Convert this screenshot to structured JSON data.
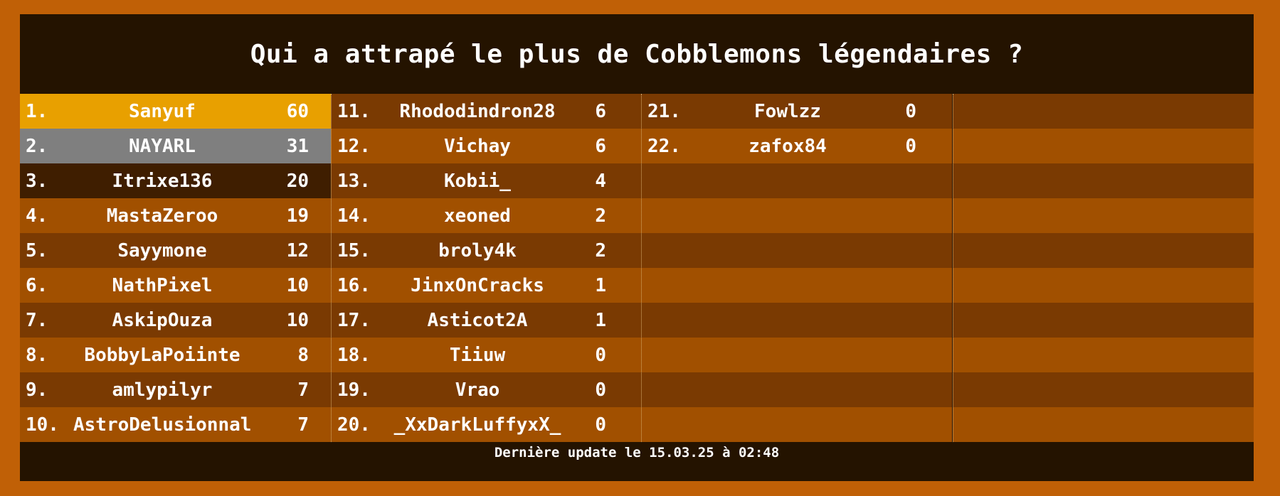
{
  "title": "Qui a attrapé le plus de Cobblemons légendaires ?",
  "footer": "Dernière update le 15.03.25 à 02:48",
  "colors": {
    "frame": "#c06006",
    "board": "#241300",
    "row_dark": "#7a3a02",
    "row_light": "#a15000",
    "gold": "#e8a000",
    "silver": "#7f7f7f",
    "bronze": "#3f1e00"
  },
  "entries": [
    {
      "rank": "1.",
      "name": "Sanyuf",
      "score": "60"
    },
    {
      "rank": "2.",
      "name": "NAYARL",
      "score": "31"
    },
    {
      "rank": "3.",
      "name": "Itrixe136",
      "score": "20"
    },
    {
      "rank": "4.",
      "name": "MastaZeroo",
      "score": "19"
    },
    {
      "rank": "5.",
      "name": "Sayymone",
      "score": "12"
    },
    {
      "rank": "6.",
      "name": "NathPixel",
      "score": "10"
    },
    {
      "rank": "7.",
      "name": "AskipOuza",
      "score": "10"
    },
    {
      "rank": "8.",
      "name": "BobbyLaPoiinte",
      "score": "8"
    },
    {
      "rank": "9.",
      "name": "amlypilyr",
      "score": "7"
    },
    {
      "rank": "10.",
      "name": "AstroDelusionnal",
      "score": "7"
    },
    {
      "rank": "11.",
      "name": "Rhododindron28",
      "score": "6"
    },
    {
      "rank": "12.",
      "name": "Vichay",
      "score": "6"
    },
    {
      "rank": "13.",
      "name": "Kobii_",
      "score": "4"
    },
    {
      "rank": "14.",
      "name": "xeoned",
      "score": "2"
    },
    {
      "rank": "15.",
      "name": "broly4k",
      "score": "2"
    },
    {
      "rank": "16.",
      "name": "JinxOnCracks",
      "score": "1"
    },
    {
      "rank": "17.",
      "name": "Asticot2A",
      "score": "1"
    },
    {
      "rank": "18.",
      "name": "Tiiuw",
      "score": "0"
    },
    {
      "rank": "19.",
      "name": "Vrao",
      "score": "0"
    },
    {
      "rank": "20.",
      "name": "_XxDarkLuffyxX_",
      "score": "0"
    },
    {
      "rank": "21.",
      "name": "Fowlzz",
      "score": "0"
    },
    {
      "rank": "22.",
      "name": "zafox84",
      "score": "0"
    }
  ]
}
